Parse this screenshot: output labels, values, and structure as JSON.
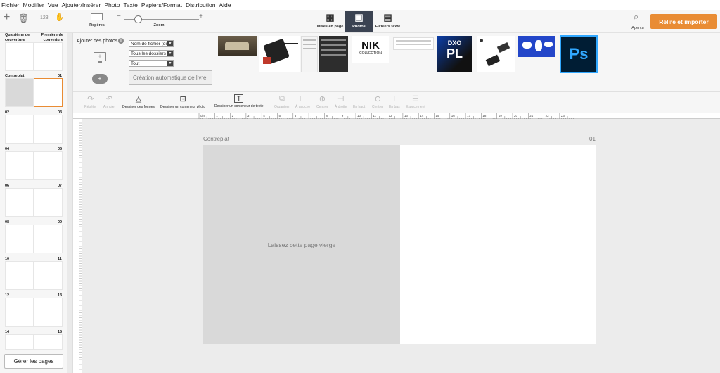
{
  "menu": [
    "Fichier",
    "Modifier",
    "Vue",
    "Ajouter/Insérer",
    "Photo",
    "Texte",
    "Papiers/Format",
    "Distribution",
    "Aide"
  ],
  "toolbar": {
    "count_label": "123",
    "guides_label": "Repères",
    "zoom_label": "Zoom",
    "minus": "−",
    "plus": "+",
    "preview_label": "Aperçu",
    "primary_button": "Relire et importer"
  },
  "modes": [
    {
      "label": "Mises en page",
      "glyph": "▦"
    },
    {
      "label": "Photos",
      "glyph": "▣"
    },
    {
      "label": "Fichiers texte",
      "glyph": "▤"
    }
  ],
  "spreads": {
    "cover_left": "Quatrième de couverture",
    "cover_right": "Première de couverture",
    "pairs": [
      [
        "Contreplat",
        "01"
      ],
      [
        "02",
        "03"
      ],
      [
        "04",
        "05"
      ],
      [
        "06",
        "07"
      ],
      [
        "08",
        "09"
      ],
      [
        "10",
        "11"
      ],
      [
        "12",
        "13"
      ],
      [
        "14",
        "15"
      ]
    ],
    "manage_button": "Gérer les pages"
  },
  "photos": {
    "add_label": "Ajouter des photos",
    "info_icon": "i",
    "sort_value": "Nom de fichier (de",
    "folder_value": "Tous les dossiers",
    "filter_value": "Tout",
    "auto_button": "Création automatique de livre",
    "thumbs": {
      "nik_text": "NIK",
      "nik_sub": "COLLECTION",
      "dxo_text": "DXO",
      "pl_text": "PL",
      "ps_text": "Ps"
    }
  },
  "tools": {
    "redo": "Répéter",
    "undo": "Annuler",
    "shapes": "Dessiner des formes",
    "photo_box": "Dessiner un conteneur photo",
    "text_box": "Dessiner un conteneur de texte",
    "arrange": "Organiser",
    "left": "À gauche",
    "center": "Centrer",
    "right": "À droite",
    "top": "En haut",
    "middle": "Centrer",
    "bottom": "En bas",
    "spacing": "Espacement",
    "text_glyph": "T"
  },
  "ruler": {
    "ticks": [
      "0in",
      "1",
      "2",
      "3",
      "4",
      "5",
      "6",
      "7",
      "8",
      "9",
      "10",
      "11",
      "12",
      "13",
      "14",
      "15",
      "16",
      "17",
      "18",
      "19",
      "20",
      "21",
      "22",
      "23"
    ]
  },
  "canvas": {
    "left_label": "Contreplat",
    "right_label": "01",
    "placeholder": "Laissez cette page vierge"
  },
  "colors": {
    "accent": "#e98c34",
    "active_tab": "#3b4352",
    "ps_blue": "#31a8ff",
    "dxo_gradient_start": "#0b3ea8"
  }
}
